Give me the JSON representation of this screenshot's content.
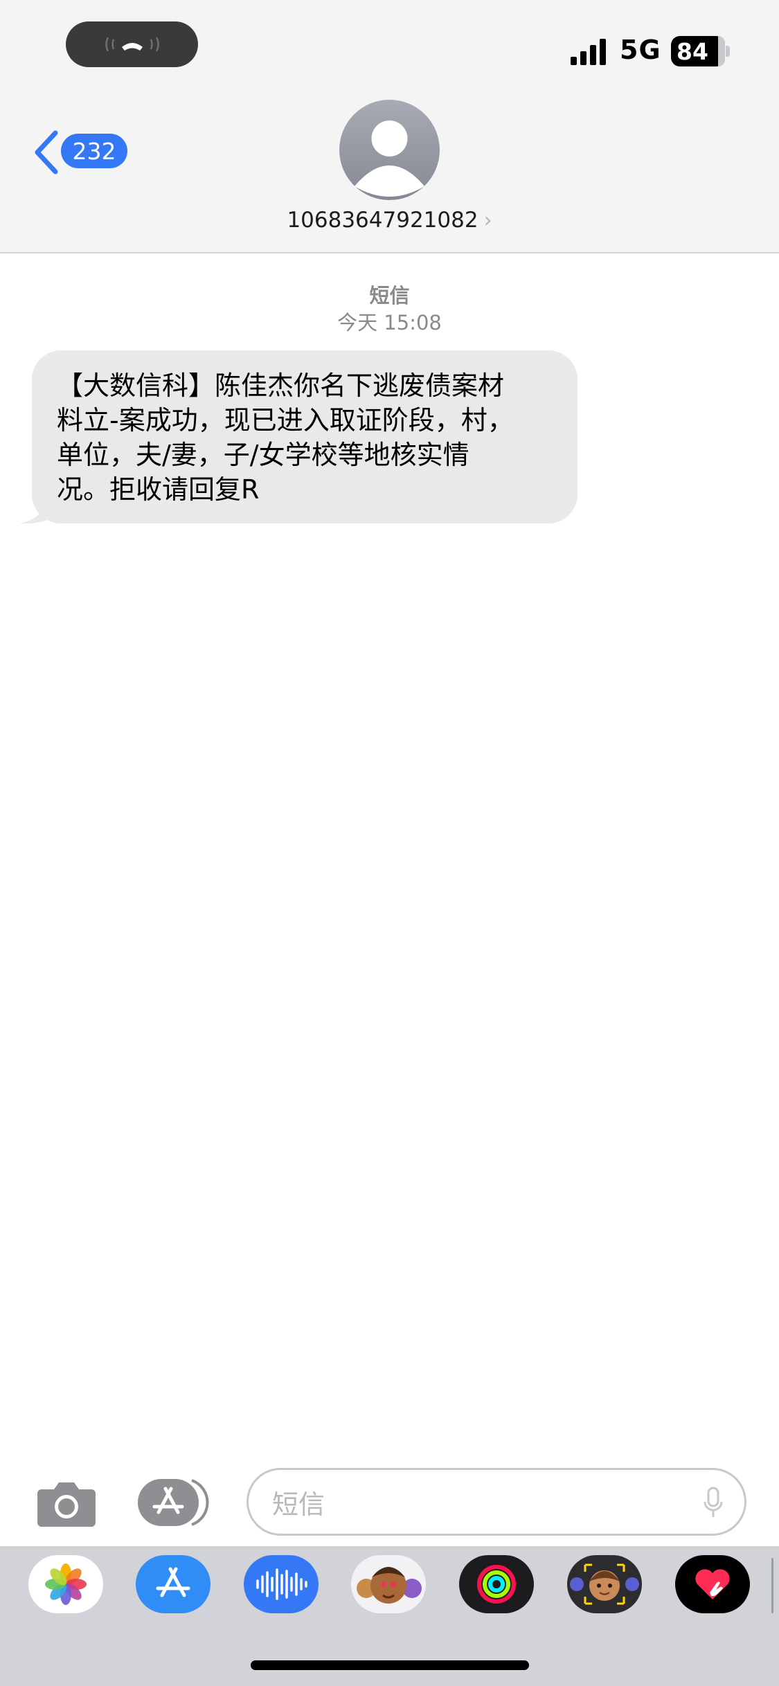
{
  "status_bar": {
    "network": "5G",
    "battery": "84"
  },
  "header": {
    "back_count": "232",
    "contact_number": "10683647921082",
    "contact_chevron": "›"
  },
  "conversation": {
    "service_label": "短信",
    "timestamp": "今天 15:08",
    "messages": [
      {
        "direction": "incoming",
        "lines": [
          "【大数信科】陈佳杰你名下逃废债案材",
          "料立-案成功，现已进入取证阶段，村，",
          "单位，夫/妻，子/女学校等地核实情",
          "况。拒收请回复R"
        ]
      }
    ]
  },
  "composer": {
    "placeholder": "短信"
  },
  "app_tray": {
    "apps": [
      {
        "name": "photos-icon"
      },
      {
        "name": "app-store-icon"
      },
      {
        "name": "audio-message-icon"
      },
      {
        "name": "memoji-stickers-icon"
      },
      {
        "name": "fitness-activity-icon"
      },
      {
        "name": "memoji-icon"
      },
      {
        "name": "digital-touch-icon"
      }
    ]
  },
  "colors": {
    "accent": "#3478f6",
    "bubble_incoming": "#e9e9eb",
    "header_bg": "#f4f4f4",
    "tray_bg": "#d1d3d9"
  }
}
